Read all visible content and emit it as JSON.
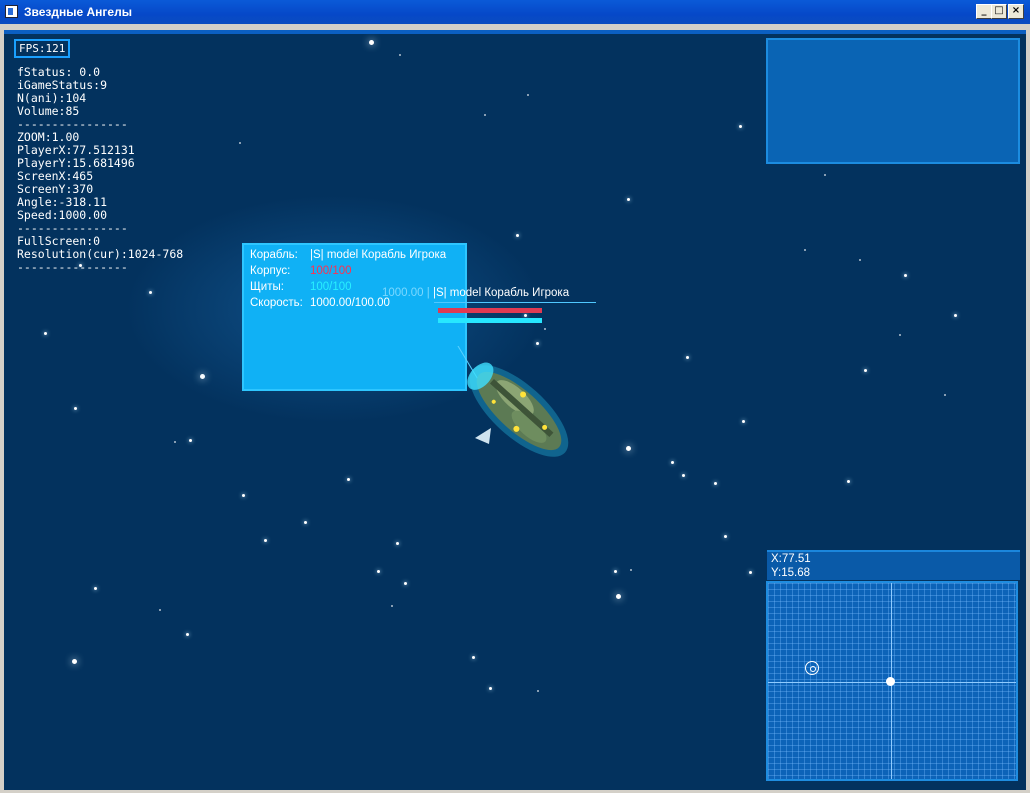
{
  "window": {
    "title": "Звездные Ангелы",
    "min_glyph": "_",
    "max_glyph": "□",
    "close_glyph": "×"
  },
  "hud": {
    "fps": "FPS:121",
    "debug_text": "fStatus: 0.0\niGameStatus:9\nN(ani):104\nVolume:85\n----------------\nZOOM:1.00\nPlayerX:77.512131\nPlayerY:15.681496\nScreenX:465\nScreenY:370\nAngle:-318.11\nSpeed:1000.00\n----------------\nFullScreen:0\nResolution(cur):1024-768\n----------------"
  },
  "info": {
    "ship_label": "Корабль:",
    "ship_value": "|S| model Корабль Игрока",
    "hull_label": "Корпус:",
    "hull_value": "100/100",
    "shields_label": "Щиты:",
    "shields_value": "100/100",
    "speed_label": "Скорость:",
    "speed_value": "1000.00/100.00"
  },
  "ship_tag": {
    "speed": "1000.00",
    "name": "|S| model Корабль Игрока",
    "hull_fraction": 1.0,
    "shield_fraction": 1.0,
    "hull_color": "#e03a52",
    "shield_color": "#27e7ff"
  },
  "radar": {
    "x": "X:77.51",
    "y": "Y:15.68"
  },
  "colors": {
    "space": "#03325e",
    "panel": "#0a64b4",
    "accent": "#1c8ce0",
    "infobox": "#10b1f5"
  }
}
